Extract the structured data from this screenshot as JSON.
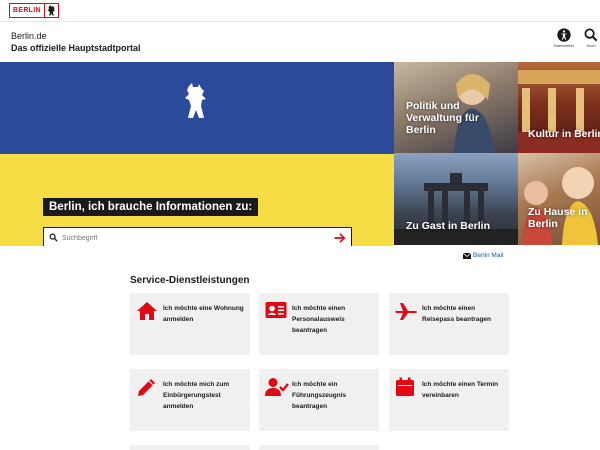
{
  "logo": {
    "text": "BERLIN"
  },
  "header": {
    "site_name": "Berlin.de",
    "site_subtitle": "Das offizielle Hauptstadtportal",
    "accessibility_label": "Barrierefrei",
    "search_label": "Such"
  },
  "hero": {
    "heading": "Berlin, ich brauche Informationen zu:",
    "search_placeholder": "Suchbegriff",
    "colors": {
      "blue": "#2c4a9a",
      "yellow": "#f7dd45"
    }
  },
  "tiles": [
    {
      "label": "Politik und Verwaltung für Berlin"
    },
    {
      "label": "Kultur in Berlin"
    },
    {
      "label": "Zu Gast in Berlin"
    },
    {
      "label": "Zu Hause in Berlin"
    }
  ],
  "mail_link": "Berlin Mail",
  "services": {
    "title": "Service-Dienstleistungen",
    "accent_color": "#e30613",
    "items": [
      {
        "icon": "house-icon",
        "label": "Ich möchte eine Wohnung anmelden"
      },
      {
        "icon": "id-card-icon",
        "label": "Ich möchte einen Personalausweis beantragen"
      },
      {
        "icon": "airplane-icon",
        "label": "Ich möchte einen Reisepass beantragen"
      },
      {
        "icon": "pencil-icon",
        "label": "Ich möchte mich zum Einbürgerungstest anmelden"
      },
      {
        "icon": "user-check-icon",
        "label": "Ich möchte ein Führungszeugnis beantragen"
      },
      {
        "icon": "calendar-icon",
        "label": "Ich möchte einen Termin vereinbaren"
      }
    ]
  }
}
